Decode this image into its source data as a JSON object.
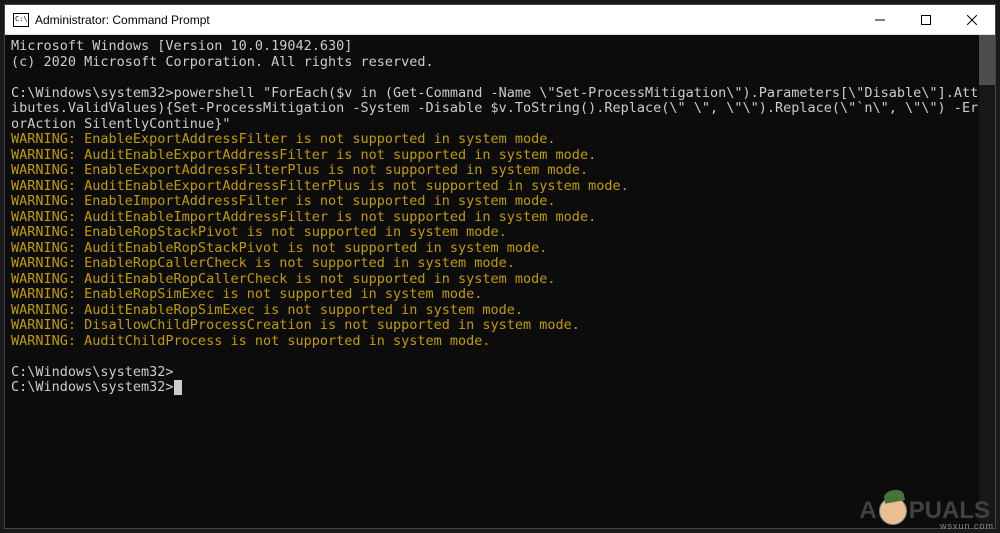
{
  "titlebar": {
    "title": "Administrator: Command Prompt"
  },
  "terminal": {
    "header1": "Microsoft Windows [Version 10.0.19042.630]",
    "header2": "(c) 2020 Microsoft Corporation. All rights reserved.",
    "prompt_path": "C:\\Windows\\system32>",
    "command": "powershell \"ForEach($v in (Get-Command -Name \\\"Set-ProcessMitigation\\\").Parameters[\\\"Disable\\\"].Attributes.ValidValues){Set-ProcessMitigation -System -Disable $v.ToString().Replace(\\\" \\\", \\\"\\\").Replace(\\\"`n\\\", \\\"\\\") -ErrorAction SilentlyContinue}\"",
    "warnings": [
      "WARNING: EnableExportAddressFilter is not supported in system mode.",
      "WARNING: AuditEnableExportAddressFilter is not supported in system mode.",
      "WARNING: EnableExportAddressFilterPlus is not supported in system mode.",
      "WARNING: AuditEnableExportAddressFilterPlus is not supported in system mode.",
      "WARNING: EnableImportAddressFilter is not supported in system mode.",
      "WARNING: AuditEnableImportAddressFilter is not supported in system mode.",
      "WARNING: EnableRopStackPivot is not supported in system mode.",
      "WARNING: AuditEnableRopStackPivot is not supported in system mode.",
      "WARNING: EnableRopCallerCheck is not supported in system mode.",
      "WARNING: AuditEnableRopCallerCheck is not supported in system mode.",
      "WARNING: EnableRopSimExec is not supported in system mode.",
      "WARNING: AuditEnableRopSimExec is not supported in system mode.",
      "WARNING: DisallowChildProcessCreation is not supported in system mode.",
      "WARNING: AuditChildProcess is not supported in system mode."
    ]
  },
  "watermark": {
    "text_before": "A",
    "text_after": "PUALS",
    "source": "wsxun.com"
  }
}
